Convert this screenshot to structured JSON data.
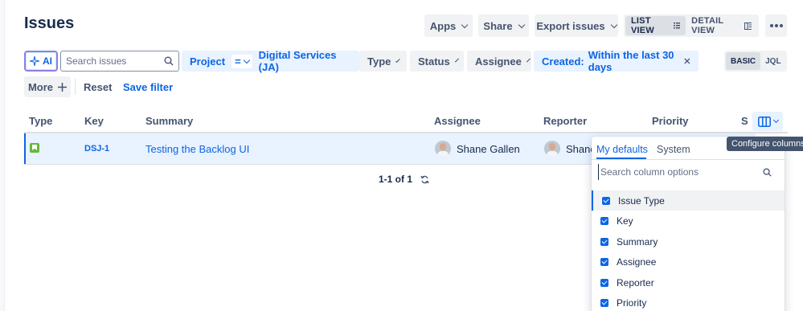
{
  "page": {
    "title": "Issues"
  },
  "toolbar": {
    "apps_label": "Apps",
    "share_label": "Share",
    "export_label": "Export issues",
    "list_view_label": "LIST VIEW",
    "detail_view_label": "DETAIL VIEW"
  },
  "filters": {
    "ai_label": "AI",
    "search_placeholder": "Search issues",
    "project_label": "Project",
    "project_operator": "=",
    "project_value": "Digital Services (JA)",
    "type_label": "Type",
    "status_label": "Status",
    "assignee_label": "Assignee",
    "created_label": "Created:",
    "created_value": "Within the last 30 days",
    "basic_label": "BASIC",
    "jql_label": "JQL",
    "more_label": "More",
    "reset_label": "Reset",
    "save_filter_label": "Save filter"
  },
  "table": {
    "columns": [
      "Type",
      "Key",
      "Summary",
      "Assignee",
      "Reporter",
      "Priority",
      "S"
    ],
    "rows": [
      {
        "type_icon": "story-icon",
        "key": "DSJ-1",
        "summary": "Testing the Backlog UI",
        "assignee": "Shane Gallen",
        "reporter": "Shane"
      }
    ]
  },
  "pagination": {
    "text": "1-1 of 1"
  },
  "column_config": {
    "tooltip": "Configure columns",
    "tabs": [
      "My defaults",
      "System"
    ],
    "search_placeholder": "Search column options",
    "options": [
      "Issue Type",
      "Key",
      "Summary",
      "Assignee",
      "Reporter",
      "Priority"
    ]
  },
  "colors": {
    "accent": "#0c66e4",
    "selected_row": "#e9f2ff",
    "story": "#63ba3c"
  }
}
